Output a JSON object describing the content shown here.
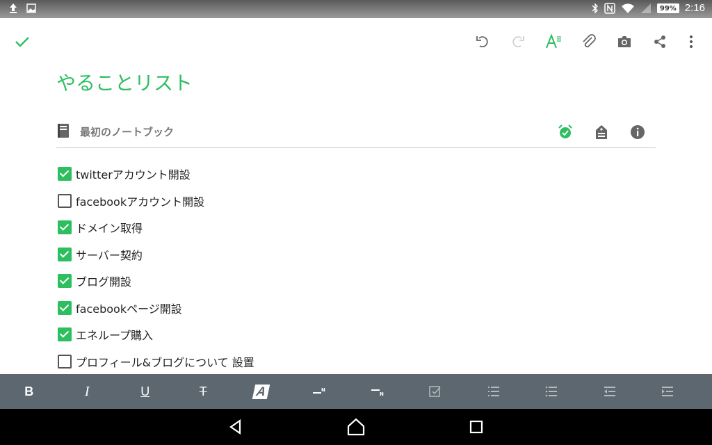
{
  "status_bar": {
    "battery": "99%",
    "time": "2:16",
    "icons": [
      "upload-icon",
      "image-icon",
      "bluetooth-icon",
      "nfc-icon",
      "wifi-icon",
      "signal-icon"
    ]
  },
  "toolbar": {
    "done_icon": "check-icon",
    "icons": [
      "undo-icon",
      "redo-icon",
      "text-format-icon",
      "attachment-icon",
      "camera-icon",
      "share-icon",
      "more-icon"
    ],
    "accent": "#2dbe60"
  },
  "note": {
    "title": "やることリスト",
    "notebook": "最初のノートブック"
  },
  "checklist": [
    {
      "label": "twitterアカウント開設",
      "checked": true
    },
    {
      "label": "facebookアカウント開設",
      "checked": false
    },
    {
      "label": "ドメイン取得",
      "checked": true
    },
    {
      "label": "サーバー契約",
      "checked": true
    },
    {
      "label": "ブログ開設",
      "checked": true
    },
    {
      "label": "facebookページ開設",
      "checked": true
    },
    {
      "label": "エネループ購入",
      "checked": true
    },
    {
      "label": "プロフィール&ブログについて 設置",
      "checked": false
    }
  ],
  "format_bar": {
    "bold": "B",
    "italic": "I",
    "underline": "U",
    "strike": "T",
    "highlight": "A"
  }
}
